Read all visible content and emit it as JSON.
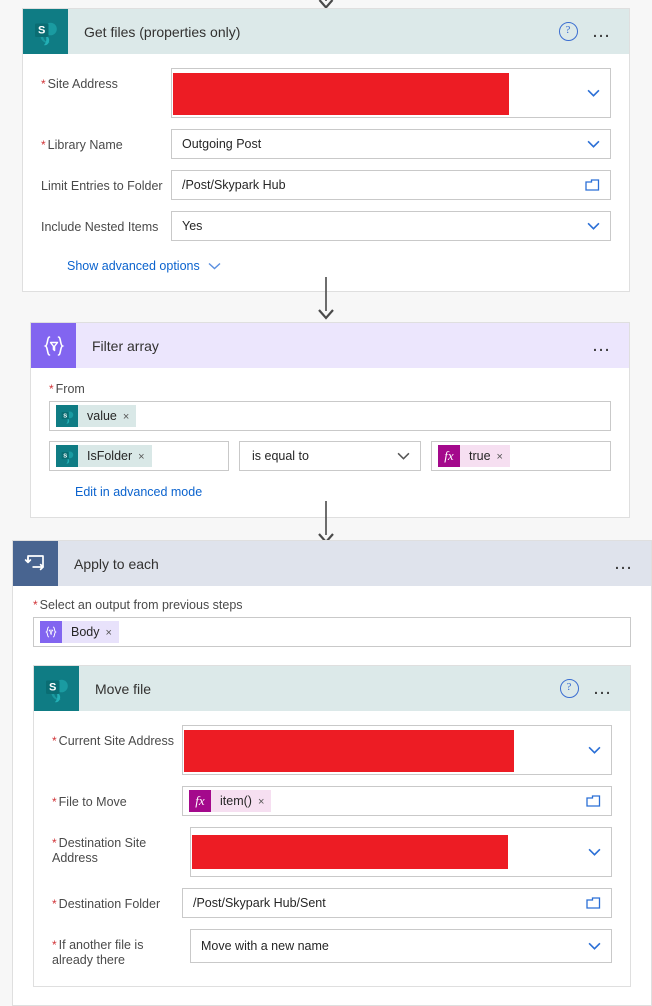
{
  "flow": {
    "steps": [
      {
        "id": "get-files",
        "title": "Get files (properties only)",
        "connector": "sharepoint",
        "icon": "sharepoint-icon",
        "help_icon": "?",
        "more_icon": "ellipsis-icon",
        "fields": [
          {
            "label": "Site Address",
            "required": true,
            "value": "",
            "redacted": true,
            "control": "dropdown"
          },
          {
            "label": "Library Name",
            "required": true,
            "value": "Outgoing Post",
            "redacted": false,
            "control": "dropdown"
          },
          {
            "label": "Limit Entries to Folder",
            "required": false,
            "value": "/Post/Skypark Hub",
            "redacted": false,
            "control": "folder-picker"
          },
          {
            "label": "Include Nested Items",
            "required": false,
            "value": "Yes",
            "redacted": false,
            "control": "dropdown"
          }
        ],
        "advanced_link": "Show advanced options"
      },
      {
        "id": "filter-array",
        "title": "Filter array",
        "connector": "control",
        "icon": "filter-array-icon",
        "more_icon": "ellipsis-icon",
        "from_label": "From",
        "from_token": {
          "text": "value",
          "icon": "sharepoint-icon",
          "remove": "×"
        },
        "condition": {
          "left": {
            "text": "IsFolder",
            "icon": "sharepoint-icon",
            "remove": "×"
          },
          "operator": "is equal to",
          "right": {
            "text": "true",
            "icon": "expression-icon",
            "remove": "×"
          }
        },
        "advanced_link": "Edit in advanced mode"
      },
      {
        "id": "apply-to-each",
        "title": "Apply to each",
        "connector": "control",
        "icon": "apply-to-each-icon",
        "more_icon": "ellipsis-icon",
        "output_label": "Select an output from previous steps",
        "output_token": {
          "text": "Body",
          "icon": "filter-array-icon",
          "remove": "×"
        }
      },
      {
        "id": "move-file",
        "title": "Move file",
        "connector": "sharepoint",
        "icon": "sharepoint-icon",
        "help_icon": "?",
        "more_icon": "ellipsis-icon",
        "fields": [
          {
            "label": "Current Site Address",
            "required": true,
            "value": "",
            "redacted": true,
            "control": "dropdown"
          },
          {
            "label": "File to Move",
            "required": true,
            "value": "item()",
            "redacted": false,
            "control": "folder-picker",
            "token": true,
            "token_icon": "expression-icon"
          },
          {
            "label": "Destination Site Address",
            "required": true,
            "value": "",
            "redacted": true,
            "control": "dropdown"
          },
          {
            "label": "Destination Folder",
            "required": true,
            "value": "/Post/Skypark Hub/Sent",
            "redacted": false,
            "control": "folder-picker"
          },
          {
            "label": "If another file is already there",
            "required": true,
            "value": "Move with a new name",
            "redacted": false,
            "control": "dropdown"
          }
        ]
      }
    ]
  },
  "colors": {
    "sharepoint_teal": "#0f7c84",
    "sharepoint_header": "#dce9e9",
    "control_purple": "#8265f0",
    "control_header": "#ece6fd",
    "loop_blue": "#486490",
    "loop_header": "#dfe3ec",
    "expression_magenta": "#a4098c",
    "link_blue": "#0b63ce",
    "required_red": "#d13438",
    "redaction_red": "#ed1c24",
    "canvas": "#f7f7f7"
  },
  "icons": {
    "chevron_down": "chevron-down-icon",
    "folder": "folder-picker-icon",
    "arrow_down": "flow-connector-arrow-icon"
  }
}
